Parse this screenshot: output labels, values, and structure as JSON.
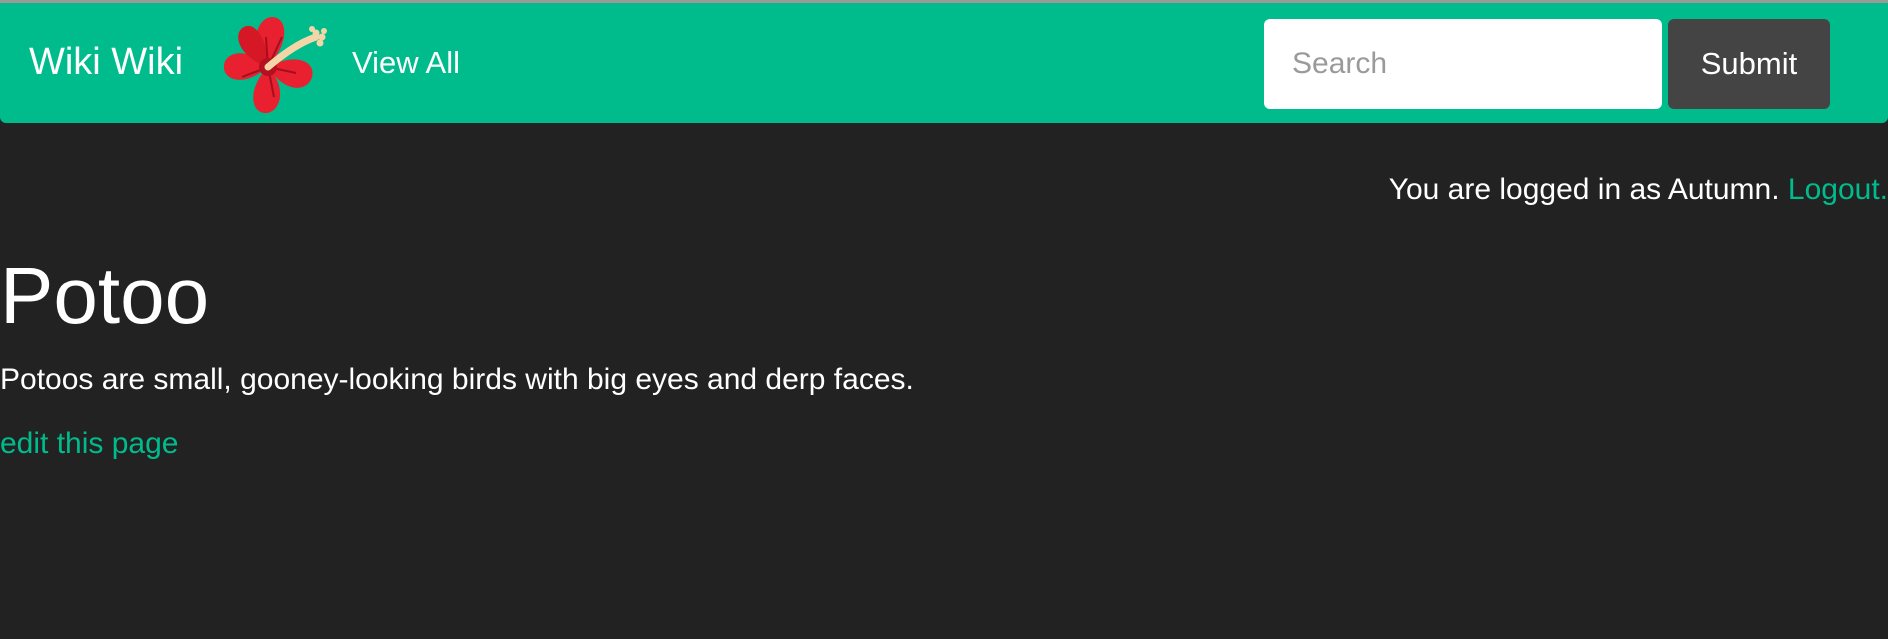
{
  "navbar": {
    "brand": "Wiki Wiki",
    "logo_icon": "hibiscus-flower-icon",
    "view_all_label": "View All",
    "search_placeholder": "Search",
    "search_value": "",
    "submit_label": "Submit",
    "background_color": "#00bc8c"
  },
  "session": {
    "status_text": "You are logged in as Autumn. ",
    "logout_label": "Logout."
  },
  "page": {
    "title": "Potoo",
    "body": "Potoos are small, gooney-looking birds with big eyes and derp faces.",
    "edit_label": "edit this page"
  },
  "colors": {
    "accent": "#00bc8c",
    "background": "#222222",
    "button": "#444444"
  }
}
